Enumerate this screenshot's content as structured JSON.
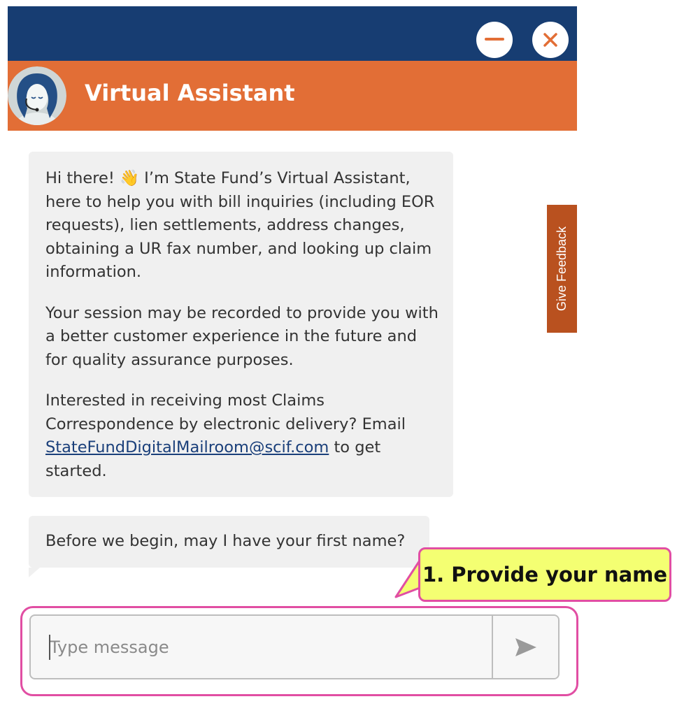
{
  "window": {
    "minimize_icon": "minus-icon",
    "close_icon": "close-icon",
    "accent_color": "#e26e36",
    "topbar_color": "#173d72"
  },
  "header": {
    "title": "Virtual Assistant",
    "avatar_icon": "assistant-avatar-icon"
  },
  "messages": [
    {
      "paragraphs": [
        "Hi there! 👋 I’m State Fund’s Virtual Assistant, here to help you with bill inquiries (including EOR requests), lien settlements, address changes, obtaining a UR fax number, and looking up claim information.",
        "Your session may be recorded to provide you with a better customer experience in the future and for quality assurance purposes."
      ],
      "p3_before": "Interested in receiving most Claims Correspondence by electronic delivery? Email ",
      "p3_link": "StateFundDigitalMailroom@scif.com",
      "p3_after": " to get started."
    },
    {
      "text": "Before we begin, may I have your first name?"
    }
  ],
  "feedback": {
    "label": "Give Feedback",
    "color": "#b9511f"
  },
  "callout": {
    "text": "1. Provide your name",
    "fill": "#f4ff72",
    "border": "#e14ea3"
  },
  "composer": {
    "placeholder": "Type message",
    "value": "",
    "send_icon": "send-arrow-icon"
  }
}
